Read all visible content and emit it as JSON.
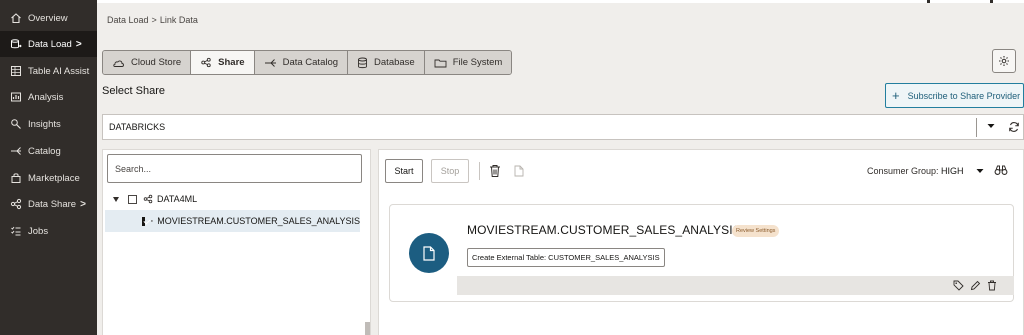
{
  "sidebar": {
    "items": [
      {
        "label": "Overview",
        "icon": "home-icon"
      },
      {
        "label": "Data Load",
        "icon": "data-load-icon",
        "active": true,
        "chevron": ">"
      },
      {
        "label": "Table AI Assist",
        "icon": "table-ai-icon"
      },
      {
        "label": "Analysis",
        "icon": "analysis-icon"
      },
      {
        "label": "Insights",
        "icon": "insights-icon"
      },
      {
        "label": "Catalog",
        "icon": "catalog-icon"
      },
      {
        "label": "Marketplace",
        "icon": "marketplace-icon"
      },
      {
        "label": "Data Share",
        "icon": "data-share-icon",
        "chevron": ">"
      },
      {
        "label": "Jobs",
        "icon": "jobs-icon"
      }
    ]
  },
  "breadcrumb": {
    "parent": "Data Load",
    "separator": ">",
    "current": "Link Data"
  },
  "toolbar": {
    "tabs": [
      {
        "label": "Cloud Store",
        "icon": "cloud-icon"
      },
      {
        "label": "Share",
        "icon": "share-icon",
        "active": true
      },
      {
        "label": "Data Catalog",
        "icon": "catalog-icon"
      },
      {
        "label": "Database",
        "icon": "database-icon"
      },
      {
        "label": "File System",
        "icon": "folder-icon"
      }
    ]
  },
  "section": {
    "title": "Select Share"
  },
  "subscribe": {
    "plus": "+",
    "label": "Subscribe to Share Provider"
  },
  "provider": {
    "value": "DATABRICKS"
  },
  "left": {
    "search_placeholder": "Search...",
    "tree": {
      "root": "DATA4ML",
      "child": "MOVIESTREAM.CUSTOMER_SALES_ANALYSIS"
    }
  },
  "right": {
    "start_label": "Start",
    "stop_label": "Stop",
    "consumer_group_label": "Consumer Group:",
    "consumer_group_value": "HIGH",
    "card": {
      "title": "MOVIESTREAM.CUSTOMER_SALES_ANALYSIS",
      "badge": "Review Settings",
      "external_table": "Create External Table: CUSTOMER_SALES_ANALYSIS"
    }
  },
  "colors": {
    "sidebar": "#312d2a",
    "accent": "#1c5d81",
    "subscribe_border": "#227e9e"
  }
}
